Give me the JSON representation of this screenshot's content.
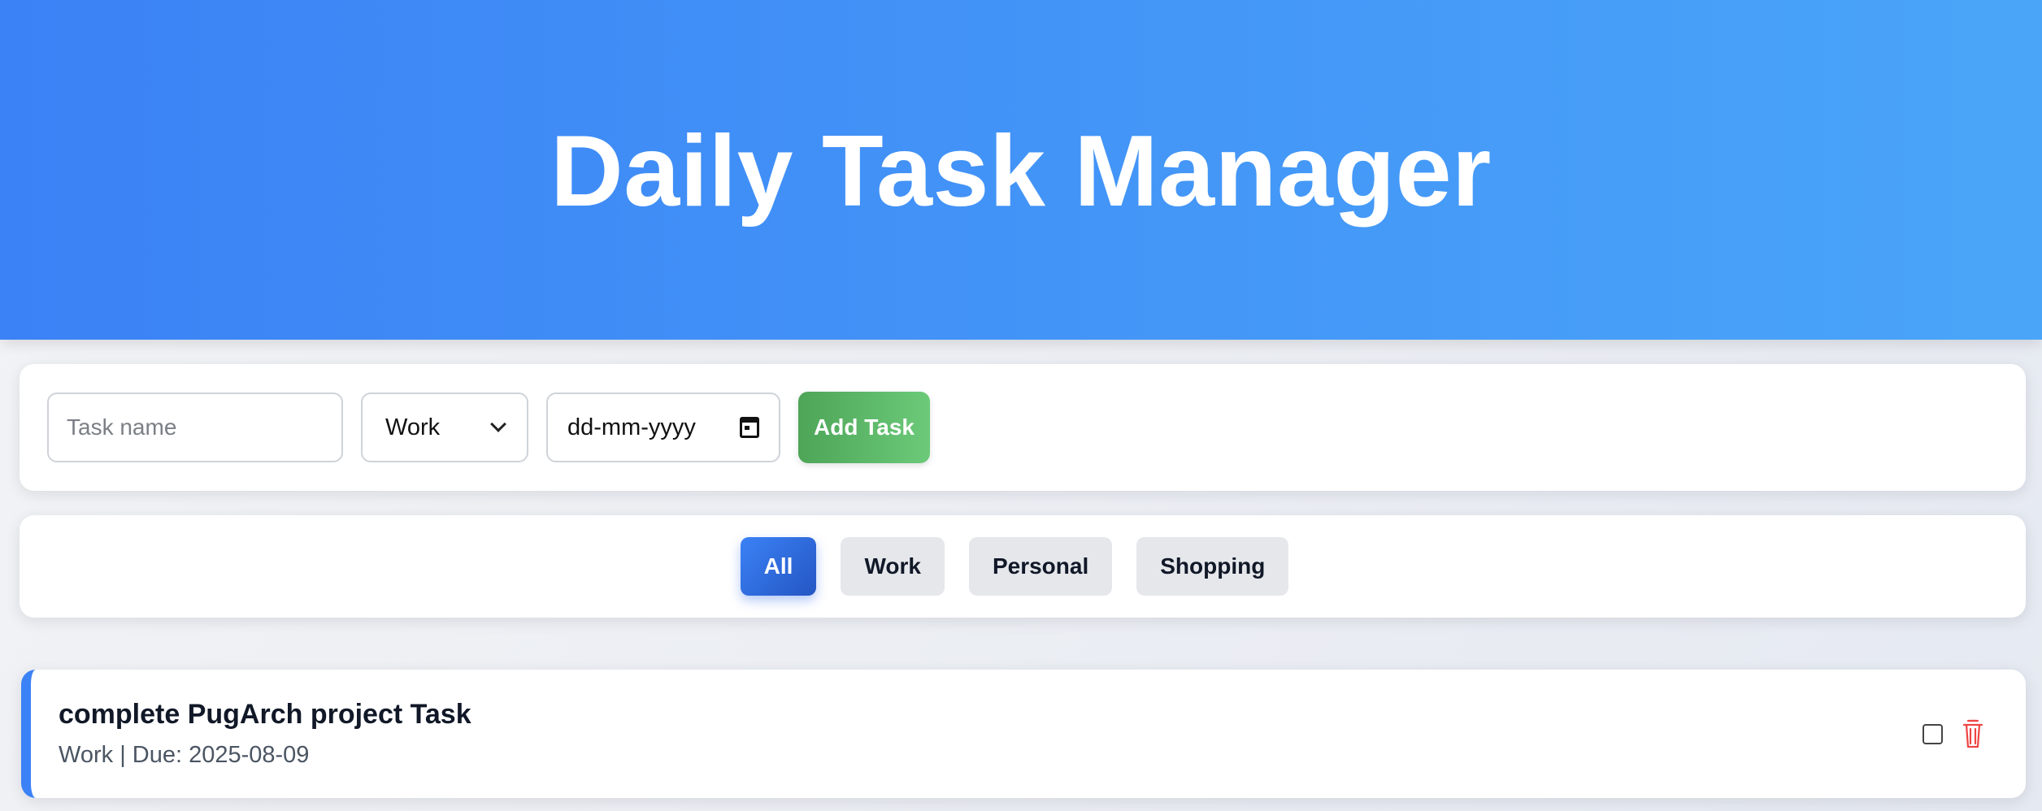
{
  "header": {
    "title": "Daily Task Manager"
  },
  "form": {
    "task_placeholder": "Task name",
    "category_value": "Work",
    "date_placeholder": "dd-mm-yyyy",
    "add_label": "Add Task"
  },
  "filters": {
    "items": [
      {
        "label": "All",
        "active": true
      },
      {
        "label": "Work",
        "active": false
      },
      {
        "label": "Personal",
        "active": false
      },
      {
        "label": "Shopping",
        "active": false
      }
    ]
  },
  "tasks": [
    {
      "title": "complete PugArch project Task",
      "meta": "Work | Due: 2025-08-09"
    }
  ],
  "colors": {
    "header_start": "#3b82f6",
    "header_end": "#4aa5f8",
    "add_button_start": "#4ea558",
    "add_button_end": "#6bca79",
    "accent": "#3b82f6",
    "delete": "#ef4444"
  },
  "icons": {
    "date": "calendar-icon",
    "delete": "trash-icon",
    "select": "chevron-down-icon"
  }
}
